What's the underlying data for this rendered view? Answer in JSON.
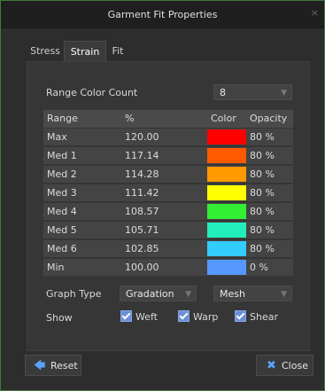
{
  "window": {
    "title": "Garment Fit Properties",
    "close_glyph": "×"
  },
  "tabs": [
    {
      "label": "Stress"
    },
    {
      "label": "Strain"
    },
    {
      "label": "Fit"
    }
  ],
  "range_color_count": {
    "label": "Range Color Count",
    "value": "8"
  },
  "table": {
    "headers": [
      "Range",
      "%",
      "Color",
      "Opacity"
    ],
    "rows": [
      {
        "range": "Max",
        "pct": "120.00",
        "color": "#ff0000",
        "opacity": "80 %"
      },
      {
        "range": "Med 1",
        "pct": "117.14",
        "color": "#ff5a00",
        "opacity": "80 %"
      },
      {
        "range": "Med 2",
        "pct": "114.28",
        "color": "#ff9900",
        "opacity": "80 %"
      },
      {
        "range": "Med 3",
        "pct": "111.42",
        "color": "#ffff00",
        "opacity": "80 %"
      },
      {
        "range": "Med 4",
        "pct": "108.57",
        "color": "#33ee33",
        "opacity": "80 %"
      },
      {
        "range": "Med 5",
        "pct": "105.71",
        "color": "#22eebb",
        "opacity": "80 %"
      },
      {
        "range": "Med 6",
        "pct": "102.85",
        "color": "#33ccff",
        "opacity": "80 %"
      },
      {
        "range": "Min",
        "pct": "100.00",
        "color": "#5599ff",
        "opacity": "0 %"
      }
    ]
  },
  "graph_type": {
    "label": "Graph Type",
    "value": "Gradation",
    "render_value": "Mesh"
  },
  "show": {
    "label": "Show",
    "options": [
      {
        "label": "Weft",
        "checked": true
      },
      {
        "label": "Warp",
        "checked": true
      },
      {
        "label": "Shear",
        "checked": true
      }
    ]
  },
  "buttons": {
    "reset": "Reset",
    "close": "Close"
  },
  "colors": {
    "accent": "#3f7a3a",
    "checkbox": "#6a8fd6",
    "reset_arrow": "#5aa0ff",
    "close_x": "#5aa0ff"
  }
}
